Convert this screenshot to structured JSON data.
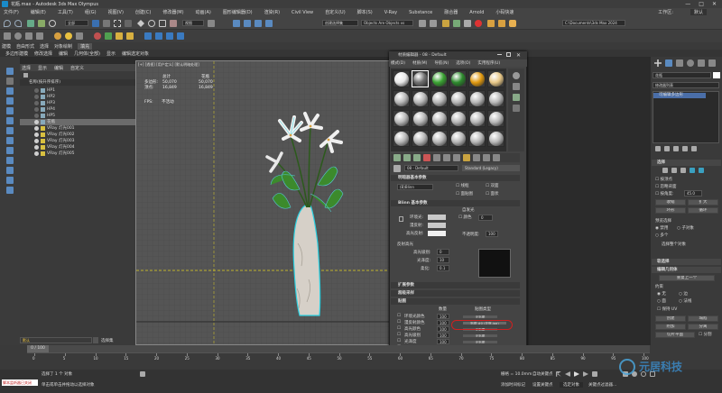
{
  "window": {
    "title": "花瓶.max - Autodesk 3ds Max Olympus",
    "controls": [
      "—",
      "□",
      "✕"
    ]
  },
  "menubar": {
    "items": [
      "文件(F)",
      "编辑(E)",
      "工具(T)",
      "组(G)",
      "视图(V)",
      "创建(C)",
      "修改器(M)",
      "动画(A)",
      "图形编辑器(D)",
      "渲染(R)",
      "Civil View",
      "自定义(U)",
      "脚本(S)",
      "V-Ray",
      "Substance",
      "融合器",
      "Arnold",
      "小码快速"
    ],
    "workspace_label": "工作区:",
    "workspace_value": "默认",
    "right_icons": [
      "user-icon",
      "help-icon"
    ]
  },
  "toolbar": {
    "view_dropdown": "全部",
    "selection_set": "创建选择集",
    "named_sets": "Objects Are Objects vs",
    "ref_coord": "视图",
    "path_field": "C:\\Documents\\3ds Max 2024"
  },
  "ribbon_tabs": [
    "建模",
    "自由形式",
    "选择",
    "对象绘制",
    "填充"
  ],
  "ribbon_sub": [
    "多边形建模",
    "修改选择",
    "编辑",
    "几何体(全部)",
    "显示",
    "编辑选定对象"
  ],
  "scene_explorer": {
    "tabs": [
      "选择",
      "显示",
      "编辑",
      "自定义"
    ],
    "header": "名称(按升序排序)",
    "rows": [
      {
        "label": "HP1",
        "visible": false,
        "selected": false
      },
      {
        "label": "HP2",
        "visible": false,
        "selected": false
      },
      {
        "label": "HP3",
        "visible": false,
        "selected": false
      },
      {
        "label": "HP4",
        "visible": false,
        "selected": false
      },
      {
        "label": "HP5",
        "visible": false,
        "selected": false
      },
      {
        "label": "花瓶",
        "visible": true,
        "selected": true
      },
      {
        "label": "VRay 灯光001",
        "visible": true,
        "selected": false
      },
      {
        "label": "VRay 灯光002",
        "visible": true,
        "selected": false
      },
      {
        "label": "VRay 灯光003",
        "visible": true,
        "selected": false
      },
      {
        "label": "VRay 灯光004",
        "visible": true,
        "selected": false
      },
      {
        "label": "VRay 灯光005",
        "visible": true,
        "selected": false
      }
    ],
    "layer_field": "默认",
    "layer_button": "选择集"
  },
  "viewport": {
    "label": "[+] [透视] [用户定义] [默认明暗处理]",
    "stats_headers": [
      "总计",
      "花瓶"
    ],
    "stats": [
      {
        "label": "多边形:",
        "total": "50,070",
        "object": "50,070"
      },
      {
        "label": "顶点:",
        "total": "16,849",
        "object": "16,849"
      }
    ],
    "fps_label": "FPS:",
    "fps_value": "不活动"
  },
  "material_editor": {
    "title": "材质编辑器 - 08 - Default",
    "menu": [
      "模式(D)",
      "材质(M)",
      "导航(N)",
      "选项(O)",
      "实用程序(U)"
    ],
    "slots": [
      {
        "color": "#e8e8e8",
        "type": "white"
      },
      {
        "color": "#707070",
        "type": "gray"
      },
      {
        "color": "#3aa332",
        "type": "green"
      },
      {
        "color": "#2d8a2d",
        "type": "green"
      },
      {
        "color": "#e29a10",
        "type": "orange"
      },
      {
        "color": "#e8c888",
        "type": "cream"
      },
      {
        "color": "#b8b8b8",
        "type": "default"
      }
    ],
    "material_name": "08 - Default",
    "material_type": "Standard (Legacy)",
    "basic_params_title": "明暗器基本参数",
    "shader": "(B)Blinn",
    "options": [
      "线框",
      "双面",
      "面贴图",
      "面状"
    ],
    "blinn_title": "Blinn 基本参数",
    "self_illum_title": "自发光",
    "color_label": "颜色",
    "color_value": "0",
    "ambient_label": "环境光:",
    "diffuse_label": "漫反射:",
    "specular_label": "高光反射:",
    "opacity_label": "不透明度:",
    "opacity_value": "100",
    "specular_hl_title": "反射高光",
    "spec_level_label": "高光级别:",
    "spec_level_value": "0",
    "gloss_label": "光泽度:",
    "gloss_value": "10",
    "soften_label": "柔化:",
    "soften_value": "0.1",
    "rollouts": [
      "扩展参数",
      "超级采样",
      "贴图"
    ],
    "maps_header": {
      "amount": "数量",
      "map_type": "贴图类型"
    },
    "maps": [
      {
        "label": "环境光颜色",
        "amount": "100",
        "map": "无贴图"
      },
      {
        "label": "漫反射颜色",
        "amount": "100",
        "map": "贴图 #0 (花瓶.jpg)",
        "highlighted": true
      },
      {
        "label": "高光颜色",
        "amount": "100",
        "map": "无贴图"
      },
      {
        "label": "高光级别",
        "amount": "100",
        "map": "无贴图"
      },
      {
        "label": "光泽度",
        "amount": "100",
        "map": "无贴图"
      },
      {
        "label": "自发光",
        "amount": "100",
        "map": "无贴图"
      },
      {
        "label": "不透明度",
        "amount": "100",
        "map": "无贴图"
      }
    ]
  },
  "command_panel": {
    "object_name": "花瓶",
    "modifier_list": "修改器列表",
    "stack_item": "可编辑多边形",
    "selection_title": "选择",
    "by_vertex": "按顶点",
    "ignore_back": "忽略背面",
    "angle_label": "按角度:",
    "angle_value": "45.0",
    "shrink": "收缩",
    "grow": "扩大",
    "ring": "环形",
    "loop": "循环",
    "preview_label": "预览选择",
    "preview_options": [
      "禁用",
      "子对象",
      "多个"
    ],
    "selected_text": "选择整个对象",
    "soft_sel": "软选择",
    "edit_geo": "编辑几何体",
    "repeat_last": "重复上一个",
    "constraints": "约束",
    "constraint_options": [
      "无",
      "边",
      "面",
      "法线"
    ],
    "preserve_uv": "保持 UV",
    "create": "创建",
    "collapse": "塌陷",
    "attach": "附加",
    "detach": "分离",
    "slice_plane": "切片平面",
    "split": "分割"
  },
  "timeline": {
    "frame": "0 / 100",
    "ticks": [
      "0",
      "5",
      "10",
      "15",
      "20",
      "25",
      "30",
      "35",
      "40",
      "45",
      "50",
      "55",
      "60",
      "65",
      "70",
      "75",
      "80",
      "85",
      "90",
      "95",
      "100"
    ]
  },
  "status": {
    "script_label": "脚本监听器已关闭",
    "selected": "选择了 1 个 对象",
    "hint": "单击或单击并拖动以选择对象",
    "grid": "栅格 = 10.0mm",
    "time_tag": "添加时间标记",
    "autokey": "自动关键点",
    "set_key": "设置关键点",
    "selected_obj": "选定对象",
    "key_filters": "关键点过滤器..."
  },
  "watermark": "元居科技"
}
